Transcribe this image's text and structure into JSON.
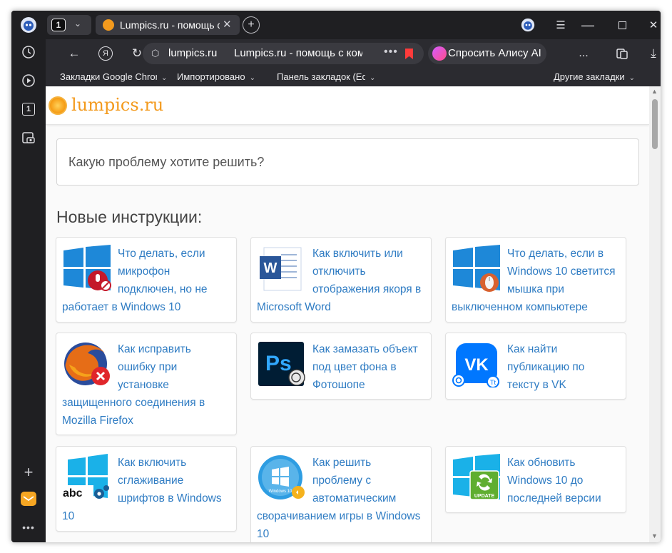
{
  "sidebar": {
    "items": [
      "history-icon",
      "video-icon",
      "tab-counter-icon",
      "screenshot-icon",
      "add-icon",
      "mail-icon",
      "more-icon"
    ],
    "counter": "1"
  },
  "tabs": {
    "counter": "1",
    "active_title": "Lumpics.ru - помощь с компьютером",
    "favicon_color": "#f39a1d"
  },
  "toolbar": {
    "domain": "lumpics.ru",
    "page_title": "Lumpics.ru - помощь с компьютером",
    "alice_label": "Спросить Алису AI",
    "more_label": "..."
  },
  "bookmarks": {
    "items": [
      "Закладки Google Chrome",
      "Импортировано",
      "Панель закладок (Edge)"
    ],
    "other": "Другие закладки"
  },
  "site": {
    "logo": "lumpics.ru",
    "search_placeholder": "Какую проблему хотите решить?",
    "section_title": "Новые инструкции:",
    "cards": [
      {
        "title": "Что делать, если микрофон подключен, но не работает в Windows 10",
        "icon": "windows-mic-icon"
      },
      {
        "title": "Как включить или отключить отображения якоря в Microsoft Word",
        "icon": "word-icon"
      },
      {
        "title": "Что делать, если в Windows 10 светится мышка при выключенном компьютере",
        "icon": "windows-mouse-icon"
      },
      {
        "title": "Как исправить ошибку при установке защищенного соединения в Mozilla Firefox",
        "icon": "firefox-error-icon"
      },
      {
        "title": "Как замазать объект под цвет фона в Фотошопе",
        "icon": "photoshop-icon"
      },
      {
        "title": "Как найти публикацию по тексту в VK",
        "icon": "vk-icon"
      },
      {
        "title": "Как включить сглаживание шрифтов в Windows 10",
        "icon": "windows-fonts-icon"
      },
      {
        "title": "Как решить проблему с автоматическим сворачиванием игры в Windows 10",
        "icon": "windows10-badge-icon"
      },
      {
        "title": "Как обновить Windows 10 до последней версии",
        "icon": "windows-update-icon"
      }
    ]
  },
  "colors": {
    "accent_link": "#2f7cc3",
    "logo_orange": "#f39a1d",
    "browser_dark": "#1f1f22"
  }
}
